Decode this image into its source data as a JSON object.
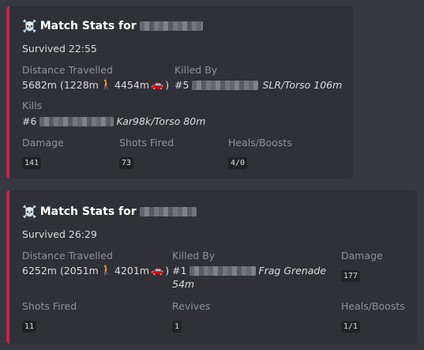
{
  "embeds": [
    {
      "title": "Match Stats for",
      "survived": "Survived 22:55",
      "distance": {
        "label": "Distance Travelled",
        "total": "5682m (1228m",
        "walk_icon": "walking-person-icon",
        "drive": "4454m",
        "car_icon": "red-car-icon",
        "close": ")"
      },
      "killed_by": {
        "label": "Killed By",
        "rank": "#5",
        "detail": "SLR/Torso 106m"
      },
      "kills": {
        "label": "Kills",
        "rank": "#6",
        "detail": "Kar98k/Torso 80m"
      },
      "damage": {
        "label": "Damage",
        "value": "141"
      },
      "shots": {
        "label": "Shots Fired",
        "value": "73"
      },
      "heals": {
        "label": "Heals/Boosts",
        "value": "4/0"
      }
    },
    {
      "title": "Match Stats for",
      "survived": "Survived 26:29",
      "distance": {
        "label": "Distance Travelled",
        "total": "6252m (2051m",
        "walk_icon": "walking-person-icon",
        "drive": "4201m",
        "car_icon": "red-car-icon",
        "close": ")"
      },
      "killed_by": {
        "label": "Killed By",
        "rank": "#1",
        "detail_line1": "Frag Grenade",
        "detail_line2": "54m"
      },
      "damage": {
        "label": "Damage",
        "value": "177"
      },
      "shots": {
        "label": "Shots Fired",
        "value": "11"
      },
      "revives": {
        "label": "Revives",
        "value": "1"
      },
      "heals": {
        "label": "Heals/Boosts",
        "value": "1/1"
      }
    }
  ],
  "icons": {
    "skull": "skull-and-crossbones-icon"
  },
  "colors": {
    "background": "#36393f",
    "embed_background": "#2f3136",
    "embed_accent": "#c2254c",
    "label": "#8e9297",
    "text": "#dcddde",
    "title": "#ffffff"
  }
}
